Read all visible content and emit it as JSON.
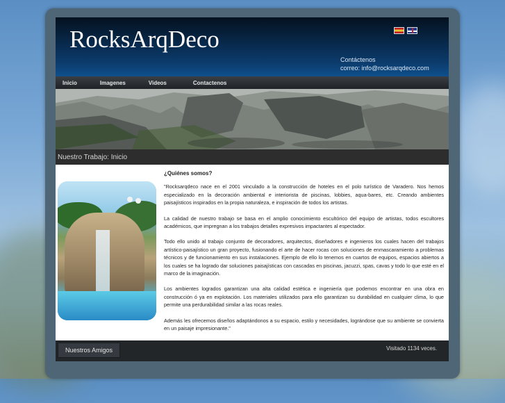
{
  "header": {
    "site_title": "RocksArqDeco",
    "contact_label": "Contáctenos",
    "contact_email": "correo: info@rocksarqdeco.com",
    "flags": [
      "es-flag-icon",
      "uk-flag-icon"
    ]
  },
  "nav": {
    "items": [
      "Inicio",
      "Imagenes",
      "Videos",
      "Contactenos"
    ]
  },
  "breadcrumb": "Nuestro Trabajo: Inicio",
  "content": {
    "question": "¿Quiénes somos?",
    "paragraphs": [
      "\"Rocksarqdeco nace en el 2001 vinculado a la construcción de hoteles en el polo turístico de Varadero. Nos hemos especializado en la decoración ambiental e interiorista de piscinas, lobbies, aqua-bares, etc. Creando ambientes paisajísticos inspirados en la propia naturaleza, e inspiración de todos los artistas.",
      "La calidad de nuestro trabajo se basa en el amplio conocimiento escultórico del equipo de artistas, todos escultores académicos, que impregnan a los trabajos detalles expresivos impactantes al espectador.",
      "Todo ello unido al trabajo conjunto de decoradores, arquitectos, diseñadores e ingenieros los cuales hacen del trabajos artístico-paisajístico un gran proyecto, fusionando el arte de hacer rocas con soluciones de enmascaramiento a problemas técnicos y de funcionamiento en sus instalaciones. Ejemplo de ello lo tenemos en cuartos de equipos, espacios abiertos a los cuales se ha logrado dar soluciones paisajísticas con cascadas en piscinas, jacuzzi, spas, cavas y todo lo que esté en el marco de la imaginación.",
      "Los ambientes logrados garantizan una alta calidad estética e ingeniería que podemos encontrar en una obra en construcción ó ya en explotación. Los materiales utilizados para ello garantizan su durabilidad en cualquier clima, lo que permite una perdurabilidad similar a las rocas reales.",
      "Además les ofrecemos diseños adaptándonos a su espacio, estilo y necesidades, lográndose que su ambiente se convierta en un paisaje impresionante.\""
    ]
  },
  "footer": {
    "friends_button": "Nuestros Amigos",
    "visits": "Visitado 1134 veces."
  }
}
